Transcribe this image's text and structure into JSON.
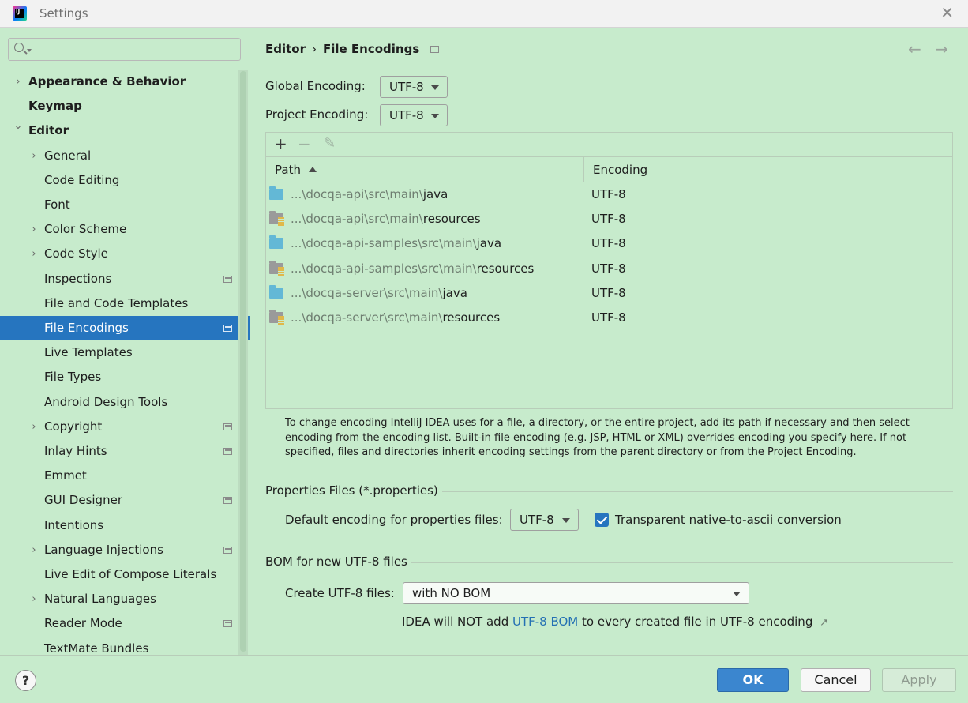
{
  "window": {
    "title": "Settings"
  },
  "search": {
    "placeholder": ""
  },
  "sidebar": {
    "items": [
      {
        "label": "Appearance & Behavior",
        "expandable": true,
        "expanded": false,
        "bold": true,
        "project_icon": false
      },
      {
        "label": "Keymap",
        "expandable": false,
        "bold": true,
        "project_icon": false
      },
      {
        "label": "Editor",
        "expandable": true,
        "expanded": true,
        "bold": true,
        "project_icon": false
      },
      {
        "label": "General",
        "expandable": true,
        "expanded": false,
        "project_icon": false
      },
      {
        "label": "Code Editing",
        "expandable": false,
        "project_icon": false
      },
      {
        "label": "Font",
        "expandable": false,
        "project_icon": false
      },
      {
        "label": "Color Scheme",
        "expandable": true,
        "expanded": false,
        "project_icon": false
      },
      {
        "label": "Code Style",
        "expandable": true,
        "expanded": false,
        "project_icon": false
      },
      {
        "label": "Inspections",
        "expandable": false,
        "project_icon": true
      },
      {
        "label": "File and Code Templates",
        "expandable": false,
        "project_icon": false
      },
      {
        "label": "File Encodings",
        "expandable": false,
        "project_icon": true,
        "selected": true
      },
      {
        "label": "Live Templates",
        "expandable": false,
        "project_icon": false
      },
      {
        "label": "File Types",
        "expandable": false,
        "project_icon": false
      },
      {
        "label": "Android Design Tools",
        "expandable": false,
        "project_icon": false
      },
      {
        "label": "Copyright",
        "expandable": true,
        "expanded": false,
        "project_icon": true
      },
      {
        "label": "Inlay Hints",
        "expandable": false,
        "project_icon": true
      },
      {
        "label": "Emmet",
        "expandable": false,
        "project_icon": false
      },
      {
        "label": "GUI Designer",
        "expandable": false,
        "project_icon": true
      },
      {
        "label": "Intentions",
        "expandable": false,
        "project_icon": false
      },
      {
        "label": "Language Injections",
        "expandable": true,
        "expanded": false,
        "project_icon": true
      },
      {
        "label": "Live Edit of Compose Literals",
        "expandable": false,
        "project_icon": false
      },
      {
        "label": "Natural Languages",
        "expandable": true,
        "expanded": false,
        "project_icon": false
      },
      {
        "label": "Reader Mode",
        "expandable": false,
        "project_icon": true
      },
      {
        "label": "TextMate Bundles",
        "expandable": false,
        "project_icon": false
      }
    ]
  },
  "breadcrumb": {
    "parent": "Editor",
    "separator": "›",
    "current": "File Encodings"
  },
  "encoding": {
    "global_label": "Global Encoding:",
    "global_value": "UTF-8",
    "project_label": "Project Encoding:",
    "project_value": "UTF-8"
  },
  "table": {
    "toolbar": {
      "add": "+",
      "remove": "−",
      "edit": "✎"
    },
    "columns": {
      "path": "Path",
      "encoding": "Encoding"
    },
    "rows": [
      {
        "folder_type": "source",
        "path_prefix": "...\\docqa-api\\src\\main\\",
        "path_name": "java",
        "encoding": "UTF-8"
      },
      {
        "folder_type": "resources",
        "path_prefix": "...\\docqa-api\\src\\main\\",
        "path_name": "resources",
        "encoding": "UTF-8"
      },
      {
        "folder_type": "source",
        "path_prefix": "...\\docqa-api-samples\\src\\main\\",
        "path_name": "java",
        "encoding": "UTF-8"
      },
      {
        "folder_type": "resources",
        "path_prefix": "...\\docqa-api-samples\\src\\main\\",
        "path_name": "resources",
        "encoding": "UTF-8"
      },
      {
        "folder_type": "source",
        "path_prefix": "...\\docqa-server\\src\\main\\",
        "path_name": "java",
        "encoding": "UTF-8"
      },
      {
        "folder_type": "resources",
        "path_prefix": "...\\docqa-server\\src\\main\\",
        "path_name": "resources",
        "encoding": "UTF-8"
      }
    ]
  },
  "hint_text": "To change encoding IntelliJ IDEA uses for a file, a directory, or the entire project, add its path if necessary and then select encoding from the encoding list. Built-in file encoding (e.g. JSP, HTML or XML) overrides encoding you specify here. If not specified, files and directories inherit encoding settings from the parent directory or from the Project Encoding.",
  "properties": {
    "section_title": "Properties Files (*.properties)",
    "default_label": "Default encoding for properties files:",
    "default_value": "UTF-8",
    "transparent_label": "Transparent native-to-ascii conversion",
    "transparent_checked": true
  },
  "bom": {
    "section_title": "BOM for new UTF-8 files",
    "create_label": "Create UTF-8 files:",
    "create_value": "with NO BOM",
    "note_before": "IDEA will NOT add ",
    "note_link": "UTF-8 BOM",
    "note_after": " to every created file in UTF-8 encoding",
    "note_arrow": "↗"
  },
  "footer": {
    "help": "?",
    "ok": "OK",
    "cancel": "Cancel",
    "apply": "Apply"
  },
  "colors": {
    "background": "#c7ebcc",
    "selection": "#2675bf",
    "link": "#2470b3",
    "primary_button": "#3b86cf",
    "source_folder": "#63b8d6"
  }
}
